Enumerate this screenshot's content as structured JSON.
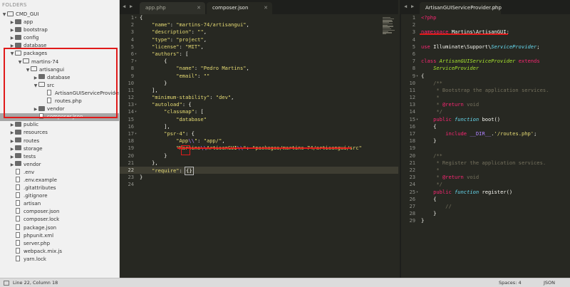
{
  "sidebar": {
    "header": "FOLDERS",
    "tree": [
      {
        "label": "CMD_GUI",
        "depth": 0,
        "kind": "folder",
        "open": true
      },
      {
        "label": "app",
        "depth": 1,
        "kind": "folder",
        "open": false
      },
      {
        "label": "bootstrap",
        "depth": 1,
        "kind": "folder",
        "open": false
      },
      {
        "label": "config",
        "depth": 1,
        "kind": "folder",
        "open": false
      },
      {
        "label": "database",
        "depth": 1,
        "kind": "folder",
        "open": false
      },
      {
        "label": "packages",
        "depth": 1,
        "kind": "folder",
        "open": true
      },
      {
        "label": "martins-74",
        "depth": 2,
        "kind": "folder",
        "open": true
      },
      {
        "label": "artisangui",
        "depth": 3,
        "kind": "folder",
        "open": true
      },
      {
        "label": "database",
        "depth": 4,
        "kind": "folder",
        "open": false
      },
      {
        "label": "src",
        "depth": 4,
        "kind": "folder",
        "open": true
      },
      {
        "label": "ArtisanGUIServiceProvider.php",
        "depth": 5,
        "kind": "file"
      },
      {
        "label": "routes.php",
        "depth": 5,
        "kind": "file"
      },
      {
        "label": "vendor",
        "depth": 4,
        "kind": "folder",
        "open": false
      },
      {
        "label": "composer.json",
        "depth": 4,
        "kind": "file",
        "selected": true
      },
      {
        "label": "public",
        "depth": 1,
        "kind": "folder",
        "open": false
      },
      {
        "label": "resources",
        "depth": 1,
        "kind": "folder",
        "open": false
      },
      {
        "label": "routes",
        "depth": 1,
        "kind": "folder",
        "open": false
      },
      {
        "label": "storage",
        "depth": 1,
        "kind": "folder",
        "open": false
      },
      {
        "label": "tests",
        "depth": 1,
        "kind": "folder",
        "open": false
      },
      {
        "label": "vendor",
        "depth": 1,
        "kind": "folder",
        "open": false
      },
      {
        "label": ".env",
        "depth": 1,
        "kind": "file"
      },
      {
        "label": ".env.example",
        "depth": 1,
        "kind": "file"
      },
      {
        "label": ".gitattributes",
        "depth": 1,
        "kind": "file"
      },
      {
        "label": ".gitignore",
        "depth": 1,
        "kind": "file"
      },
      {
        "label": "artisan",
        "depth": 1,
        "kind": "file"
      },
      {
        "label": "composer.json",
        "depth": 1,
        "kind": "file"
      },
      {
        "label": "composer.lock",
        "depth": 1,
        "kind": "file"
      },
      {
        "label": "package.json",
        "depth": 1,
        "kind": "file"
      },
      {
        "label": "phpunit.xml",
        "depth": 1,
        "kind": "file"
      },
      {
        "label": "server.php",
        "depth": 1,
        "kind": "file"
      },
      {
        "label": "webpack.mix.js",
        "depth": 1,
        "kind": "file"
      },
      {
        "label": "yarn.lock",
        "depth": 1,
        "kind": "file"
      }
    ]
  },
  "pane1": {
    "tabs": [
      {
        "label": "app.php",
        "active": false
      },
      {
        "label": "composer.json",
        "active": true
      }
    ],
    "lines": [
      {
        "n": "1",
        "parts": [
          [
            "p",
            "{"
          ]
        ]
      },
      {
        "n": "2",
        "parts": [
          [
            "p",
            "    "
          ],
          [
            "s",
            "\"name\""
          ],
          [
            "p",
            ": "
          ],
          [
            "s",
            "\"martins-74/artisangui\""
          ],
          [
            "p",
            ","
          ]
        ]
      },
      {
        "n": "3",
        "parts": [
          [
            "p",
            "    "
          ],
          [
            "s",
            "\"description\""
          ],
          [
            "p",
            ": "
          ],
          [
            "s",
            "\"\""
          ],
          [
            "p",
            ","
          ]
        ]
      },
      {
        "n": "4",
        "parts": [
          [
            "p",
            "    "
          ],
          [
            "s",
            "\"type\""
          ],
          [
            "p",
            ": "
          ],
          [
            "s",
            "\"project\""
          ],
          [
            "p",
            ","
          ]
        ]
      },
      {
        "n": "5",
        "parts": [
          [
            "p",
            "    "
          ],
          [
            "s",
            "\"license\""
          ],
          [
            "p",
            ": "
          ],
          [
            "s",
            "\"MIT\""
          ],
          [
            "p",
            ","
          ]
        ]
      },
      {
        "n": "6",
        "parts": [
          [
            "p",
            "    "
          ],
          [
            "s",
            "\"authors\""
          ],
          [
            "p",
            ": ["
          ]
        ]
      },
      {
        "n": "7",
        "parts": [
          [
            "p",
            "        {"
          ]
        ]
      },
      {
        "n": "8",
        "parts": [
          [
            "p",
            "            "
          ],
          [
            "s",
            "\"name\""
          ],
          [
            "p",
            ": "
          ],
          [
            "s",
            "\"Pedro Martins\""
          ],
          [
            "p",
            ","
          ]
        ]
      },
      {
        "n": "9",
        "parts": [
          [
            "p",
            "            "
          ],
          [
            "s",
            "\"email\""
          ],
          [
            "p",
            ": "
          ],
          [
            "s",
            "\"\""
          ]
        ]
      },
      {
        "n": "10",
        "parts": [
          [
            "p",
            "        }"
          ]
        ]
      },
      {
        "n": "11",
        "parts": [
          [
            "p",
            "    ],"
          ]
        ]
      },
      {
        "n": "12",
        "parts": [
          [
            "p",
            "    "
          ],
          [
            "s",
            "\"minimum-stability\""
          ],
          [
            "p",
            ": "
          ],
          [
            "s",
            "\"dev\""
          ],
          [
            "p",
            ","
          ]
        ]
      },
      {
        "n": "13",
        "parts": [
          [
            "p",
            "    "
          ],
          [
            "s",
            "\"autoload\""
          ],
          [
            "p",
            ": {"
          ]
        ]
      },
      {
        "n": "14",
        "parts": [
          [
            "p",
            "        "
          ],
          [
            "s",
            "\"classmap\""
          ],
          [
            "p",
            ": ["
          ]
        ]
      },
      {
        "n": "15",
        "parts": [
          [
            "p",
            "            "
          ],
          [
            "s",
            "\"database\""
          ]
        ]
      },
      {
        "n": "16",
        "parts": [
          [
            "p",
            "        ],"
          ]
        ]
      },
      {
        "n": "17",
        "parts": [
          [
            "p",
            "        "
          ],
          [
            "s",
            "\"psr-4\""
          ],
          [
            "p",
            ": {"
          ]
        ]
      },
      {
        "n": "18",
        "parts": [
          [
            "p",
            "            "
          ],
          [
            "s",
            "\"App"
          ],
          [
            "e",
            "\\\\"
          ],
          [
            "s",
            "\""
          ],
          [
            "p",
            ": "
          ],
          [
            "s",
            "\"app/\""
          ],
          [
            "p",
            ","
          ]
        ]
      },
      {
        "n": "19",
        "parts": [
          [
            "p",
            "            "
          ],
          [
            "s",
            "\"Martins"
          ],
          [
            "e",
            "\\\\"
          ],
          [
            "s",
            "ArtisanGUI"
          ],
          [
            "e",
            "\\\\"
          ],
          [
            "s",
            "\""
          ],
          [
            "p",
            ": "
          ],
          [
            "s",
            "\"packages/martins-74/artisangui/src\""
          ]
        ]
      },
      {
        "n": "20",
        "parts": [
          [
            "p",
            "        }"
          ]
        ]
      },
      {
        "n": "21",
        "parts": [
          [
            "p",
            "    },"
          ]
        ]
      },
      {
        "n": "22",
        "parts": [
          [
            "p",
            "    "
          ],
          [
            "s",
            "\"require\""
          ],
          [
            "p",
            ": "
          ],
          [
            "c",
            "{}"
          ]
        ],
        "current": true
      },
      {
        "n": "23",
        "parts": [
          [
            "p",
            "}"
          ]
        ]
      },
      {
        "n": "24",
        "parts": []
      }
    ]
  },
  "pane2": {
    "tabs": [
      {
        "label": "ArtisanGUIServiceProvider.php",
        "active": true
      }
    ],
    "lines": [
      {
        "n": "1",
        "parts": [
          [
            "t",
            "<?php"
          ]
        ]
      },
      {
        "n": "2",
        "parts": []
      },
      {
        "n": "3",
        "parts": [
          [
            "k",
            "namespace"
          ],
          [
            "p",
            " Martins"
          ],
          [
            "p",
            "\\"
          ],
          [
            "p",
            "ArtisanGUI;"
          ]
        ]
      },
      {
        "n": "4",
        "parts": []
      },
      {
        "n": "5",
        "parts": [
          [
            "k",
            "use"
          ],
          [
            "p",
            " Illuminate\\Support\\"
          ],
          [
            "f",
            "ServiceProvider"
          ],
          [
            "p",
            ";"
          ]
        ]
      },
      {
        "n": "6",
        "parts": []
      },
      {
        "n": "7",
        "parts": [
          [
            "k",
            "class"
          ],
          [
            "p",
            " "
          ],
          [
            "g",
            "ArtisanGUIServiceProvider"
          ],
          [
            "p",
            " "
          ],
          [
            "k",
            "extends"
          ]
        ]
      },
      {
        "n": "8",
        "parts": [
          [
            "p",
            "    "
          ],
          [
            "g",
            "ServiceProvider"
          ]
        ]
      },
      {
        "n": "9",
        "parts": [
          [
            "p",
            "{"
          ]
        ]
      },
      {
        "n": "10",
        "parts": [
          [
            "p",
            "    "
          ],
          [
            "m",
            "/**"
          ]
        ]
      },
      {
        "n": "11",
        "parts": [
          [
            "p",
            "    "
          ],
          [
            "m",
            " * Bootstrap the application services."
          ]
        ]
      },
      {
        "n": "12",
        "parts": [
          [
            "p",
            "    "
          ],
          [
            "m",
            " *"
          ]
        ]
      },
      {
        "n": "13",
        "parts": [
          [
            "p",
            "    "
          ],
          [
            "m",
            " * "
          ],
          [
            "k",
            "@return"
          ],
          [
            "m",
            " void"
          ]
        ]
      },
      {
        "n": "14",
        "parts": [
          [
            "p",
            "    "
          ],
          [
            "m",
            " */"
          ]
        ]
      },
      {
        "n": "15",
        "parts": [
          [
            "p",
            "    "
          ],
          [
            "k",
            "public"
          ],
          [
            "p",
            " "
          ],
          [
            "f",
            "function"
          ],
          [
            "p",
            " boot()"
          ]
        ]
      },
      {
        "n": "16",
        "parts": [
          [
            "p",
            "    {"
          ]
        ]
      },
      {
        "n": "17",
        "parts": [
          [
            "p",
            "        "
          ],
          [
            "k",
            "include"
          ],
          [
            "p",
            " "
          ],
          [
            "n",
            "__DIR__"
          ],
          [
            "p",
            "."
          ],
          [
            "s",
            "'/routes.php'"
          ],
          [
            "p",
            ";"
          ]
        ]
      },
      {
        "n": "18",
        "parts": [
          [
            "p",
            "    }"
          ]
        ]
      },
      {
        "n": "19",
        "parts": []
      },
      {
        "n": "20",
        "parts": [
          [
            "p",
            "    "
          ],
          [
            "m",
            "/**"
          ]
        ]
      },
      {
        "n": "21",
        "parts": [
          [
            "p",
            "    "
          ],
          [
            "m",
            " * Register the application services."
          ]
        ]
      },
      {
        "n": "22",
        "parts": [
          [
            "p",
            "    "
          ],
          [
            "m",
            " *"
          ]
        ]
      },
      {
        "n": "23",
        "parts": [
          [
            "p",
            "    "
          ],
          [
            "m",
            " * "
          ],
          [
            "k",
            "@return"
          ],
          [
            "m",
            " void"
          ]
        ]
      },
      {
        "n": "24",
        "parts": [
          [
            "p",
            "    "
          ],
          [
            "m",
            " */"
          ]
        ]
      },
      {
        "n": "25",
        "parts": [
          [
            "p",
            "    "
          ],
          [
            "k",
            "public"
          ],
          [
            "p",
            " "
          ],
          [
            "f",
            "function"
          ],
          [
            "p",
            " register()"
          ]
        ]
      },
      {
        "n": "26",
        "parts": [
          [
            "p",
            "    {"
          ]
        ]
      },
      {
        "n": "27",
        "parts": [
          [
            "p",
            "        "
          ],
          [
            "m",
            "//"
          ]
        ]
      },
      {
        "n": "28",
        "parts": [
          [
            "p",
            "    }"
          ]
        ]
      },
      {
        "n": "29",
        "parts": [
          [
            "p",
            "}"
          ]
        ]
      }
    ]
  },
  "statusbar": {
    "position": "Line 22, Column 18",
    "spaces": "Spaces: 4",
    "syntax": "JSON"
  },
  "nav": {
    "left": "◀",
    "right": "▶"
  }
}
